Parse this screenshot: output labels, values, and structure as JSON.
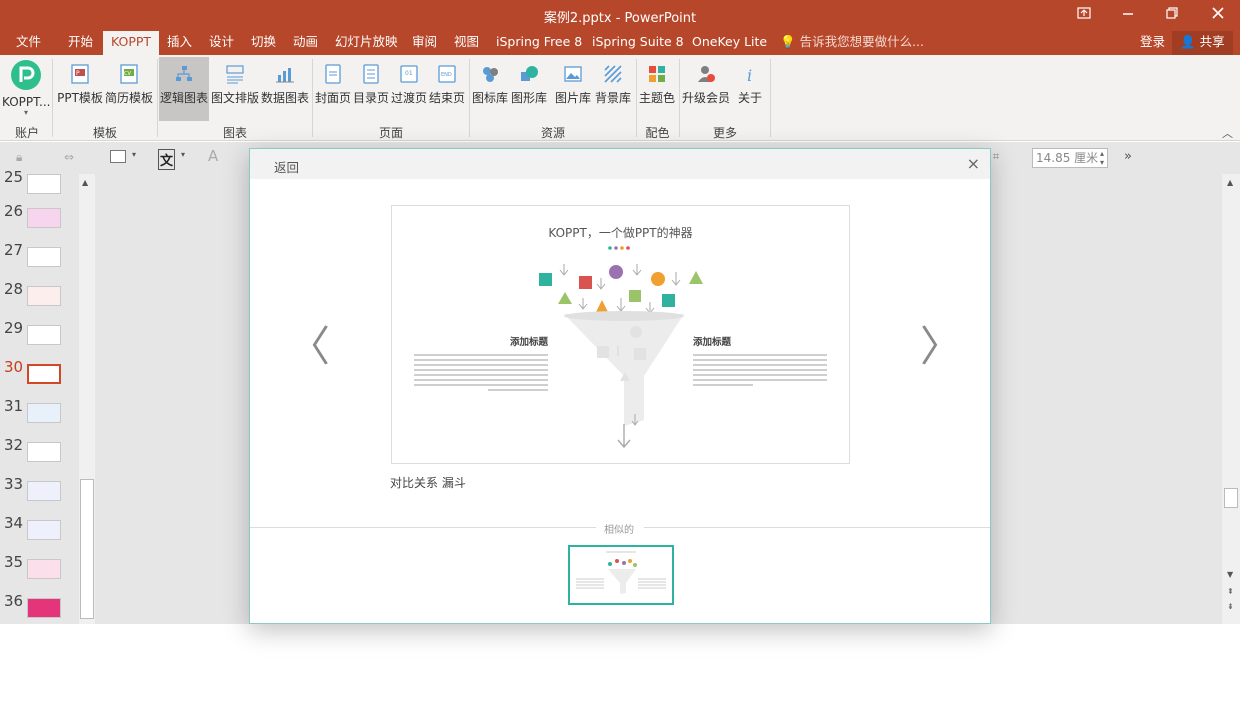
{
  "window": {
    "title": "案例2.pptx - PowerPoint",
    "controls": [
      "restore-ribbon",
      "minimize",
      "maximize",
      "close"
    ]
  },
  "tabs": [
    {
      "label": "文件"
    },
    {
      "label": "开始"
    },
    {
      "label": "KOPPT",
      "active": true
    },
    {
      "label": "插入"
    },
    {
      "label": "设计"
    },
    {
      "label": "切换"
    },
    {
      "label": "动画"
    },
    {
      "label": "幻灯片放映"
    },
    {
      "label": "审阅"
    },
    {
      "label": "视图"
    },
    {
      "label": "iSpring Free 8"
    },
    {
      "label": "iSpring Suite 8"
    },
    {
      "label": "OneKey Lite"
    }
  ],
  "tellme": "告诉我您想要做什么...",
  "account": {
    "login": "登录",
    "share": "共享"
  },
  "ribbon": {
    "account_btn": "KOPPT...",
    "groups": [
      {
        "label": "账户"
      },
      {
        "label": "模板"
      },
      {
        "label": "图表"
      },
      {
        "label": "页面"
      },
      {
        "label": "资源"
      },
      {
        "label": "配色"
      },
      {
        "label": "更多"
      }
    ],
    "buttons": [
      {
        "label": "PPT模板"
      },
      {
        "label": "简历模板"
      },
      {
        "label": "逻辑图表"
      },
      {
        "label": "图文排版"
      },
      {
        "label": "数据图表"
      },
      {
        "label": "封面页"
      },
      {
        "label": "目录页"
      },
      {
        "label": "过渡页"
      },
      {
        "label": "结束页"
      },
      {
        "label": "图标库"
      },
      {
        "label": "图形库"
      },
      {
        "label": "图片库"
      },
      {
        "label": "背景库"
      },
      {
        "label": "主题色"
      },
      {
        "label": "升级会员"
      },
      {
        "label": "关于"
      }
    ]
  },
  "format_bar": {
    "width_value": "14.85 厘米",
    "text_btn": "文",
    "font_btn": "A"
  },
  "thumbnails": [
    {
      "num": "25"
    },
    {
      "num": "26"
    },
    {
      "num": "27"
    },
    {
      "num": "28"
    },
    {
      "num": "29"
    },
    {
      "num": "30",
      "current": true
    },
    {
      "num": "31"
    },
    {
      "num": "32"
    },
    {
      "num": "33"
    },
    {
      "num": "34"
    },
    {
      "num": "35"
    },
    {
      "num": "36"
    }
  ],
  "dialog": {
    "back": "返回",
    "close": "×",
    "prev": "〈",
    "next": "〉",
    "preview": {
      "title": "KOPPT，一个做PPT的神器",
      "left_heading": "添加标题",
      "right_heading": "添加标题"
    },
    "caption": "对比关系 漏斗",
    "similar_label": "相似的"
  },
  "colors": {
    "accent": "#b7472a",
    "teal": "#2fb3a0",
    "red": "#d9534f",
    "purple": "#9b72b0",
    "orange": "#f0a030",
    "green": "#9bc46a"
  }
}
